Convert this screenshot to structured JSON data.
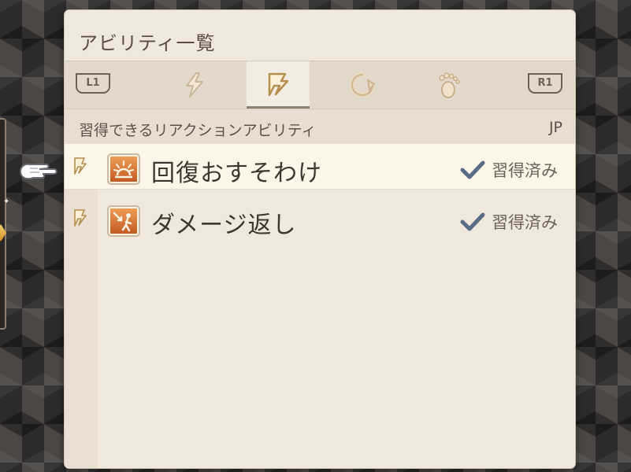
{
  "panel": {
    "title": "アビリティ一覧"
  },
  "tabs": {
    "left_shoulder": "L1",
    "right_shoulder": "R1",
    "items": [
      {
        "icon": "action-ability-icon",
        "active": false
      },
      {
        "icon": "reaction-ability-icon",
        "active": true
      },
      {
        "icon": "support-ability-icon",
        "active": false
      },
      {
        "icon": "movement-ability-icon",
        "active": false
      }
    ]
  },
  "section": {
    "label": "習得できるリアクションアビリティ",
    "jp_label": "JP"
  },
  "abilities": [
    {
      "name": "回復おすそわけ",
      "status": "習得済み",
      "icon": "heal-share-icon",
      "selected": true
    },
    {
      "name": "ダメージ返し",
      "status": "習得済み",
      "icon": "counter-damage-icon",
      "selected": false
    }
  ],
  "colors": {
    "panel_bg": "#f0e8dd",
    "ability_icon": "#d0662a",
    "check": "#5b6c86"
  }
}
